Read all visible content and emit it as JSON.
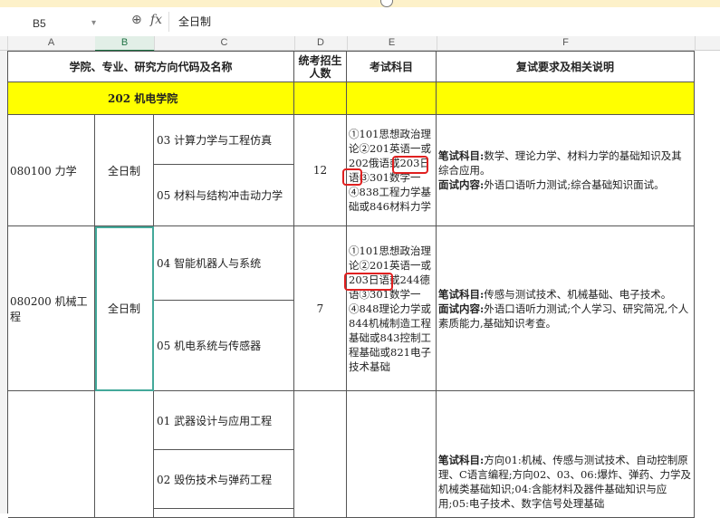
{
  "formula_bar": {
    "cell_ref": "B5",
    "dropdown_glyph": "▾",
    "zoom_icon": "⊕",
    "fx_label": "fx",
    "content": "全日制"
  },
  "columns": [
    "A",
    "B",
    "C",
    "D",
    "E",
    "F"
  ],
  "header_row": {
    "col_a": "学院、专业、研究方向代码及名称",
    "col_d": "统考招生人数",
    "col_e": "考试科目",
    "col_f": "复试要求及相关说明"
  },
  "college_row": {
    "title": "202  机电学院",
    "color": "#ffff00"
  },
  "rows": [
    {
      "major": "080100  力学",
      "mode": "全日制",
      "directions": [
        "03  计算力学与工程仿真",
        "05  材料与结构冲击动力学"
      ],
      "quota": "12",
      "exam": "①101思想政治理论②201英语一或202俄语或203日语③301数学一④838工程力学基础或846材料力学",
      "note_label_1": "笔试科目:",
      "note_text_1": "数学、理论力学、材料力学的基础知识及其综合应用。",
      "note_label_2": "面试内容:",
      "note_text_2": "外语口语听力测试;综合基础知识面试。"
    },
    {
      "major": "080200  机械工程",
      "mode": "全日制",
      "directions": [
        "04  智能机器人与系统",
        "05  机电系统与传感器"
      ],
      "quota": "7",
      "exam": "①101思想政治理论②201英语一或203日语或244德语③301数学一④848理论力学或844机械制造工程基础或843控制工程基础或821电子技术基础",
      "note_label_1": "笔试科目:",
      "note_text_1": "传感与测试技术、机械基础、电子技术。",
      "note_label_2": "面试内容:",
      "note_text_2": "外语口语听力测试;个人学习、研究简况,个人素质能力,基础知识考查。"
    },
    {
      "directions": [
        "01  武器设计与应用工程",
        "02  毁伤技术与弹药工程"
      ],
      "note_label_1": "笔试科目:",
      "note_text_1": "方向01:机械、传感与测试技术、自动控制原理、C语言编程;方向02、03、06:爆炸、弹药、力学及机械类基础知识;04:含能材料及器件基础知识与应用;05:电子技术、数字信号处理基础"
    }
  ]
}
